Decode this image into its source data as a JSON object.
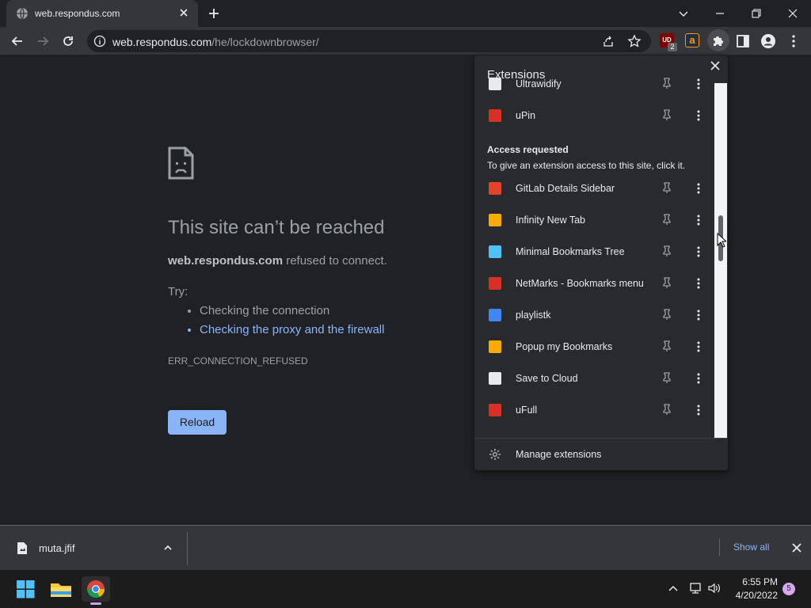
{
  "browser": {
    "tab_title": "web.respondus.com",
    "url_domain": "web.respondus.com",
    "url_path": "/he/lockdownbrowser/",
    "extension_badges": {
      "ublock_count": "2",
      "ublock_label": "UD",
      "amazon_label": "a"
    }
  },
  "error_page": {
    "title": "This site can’t be reached",
    "host": "web.respondus.com",
    "desc_suffix": " refused to connect.",
    "try_label": "Try:",
    "suggestions": [
      {
        "text": "Checking the connection",
        "is_link": false
      },
      {
        "text": "Checking the proxy and the firewall",
        "is_link": true
      }
    ],
    "error_code": "ERR_CONNECTION_REFUSED",
    "reload_label": "Reload"
  },
  "extensions_popup": {
    "title": "Extensions",
    "top_items": [
      {
        "name": "Ultrawidify",
        "icon": "ultrawidify-icon",
        "color": "#e8eaed"
      },
      {
        "name": "uPin",
        "icon": "upin-icon",
        "color": "#d93025"
      }
    ],
    "access_heading": "Access requested",
    "access_desc": "To give an extension access to this site, click it.",
    "access_items": [
      {
        "name": "GitLab Details Sidebar",
        "icon": "gitlab-icon",
        "color": "#e24329"
      },
      {
        "name": "Infinity New Tab",
        "icon": "infinity-icon",
        "color": "#f9ab00"
      },
      {
        "name": "Minimal Bookmarks Tree",
        "icon": "bookmarks-tree-icon",
        "color": "#4fc3f7"
      },
      {
        "name": "NetMarks - Bookmarks menu",
        "icon": "netmarks-icon",
        "color": "#d93025"
      },
      {
        "name": "playlistk",
        "icon": "playlistk-icon",
        "color": "#4285f4"
      },
      {
        "name": "Popup my Bookmarks",
        "icon": "popup-bookmarks-icon",
        "color": "#f9ab00"
      },
      {
        "name": "Save to Cloud",
        "icon": "save-to-cloud-icon",
        "color": "#e8eaed"
      },
      {
        "name": "uFull",
        "icon": "ufull-icon",
        "color": "#d93025"
      }
    ],
    "manage_label": "Manage extensions"
  },
  "download_shelf": {
    "file_name": "muta.jfif",
    "show_all_label": "Show all"
  },
  "taskbar": {
    "time": "6:55 PM",
    "date": "4/20/2022",
    "notification_count": "5"
  },
  "colors": {
    "accent_blue": "#8ab4f8",
    "page_bg": "#202124",
    "toolbar_bg": "#35363a"
  }
}
